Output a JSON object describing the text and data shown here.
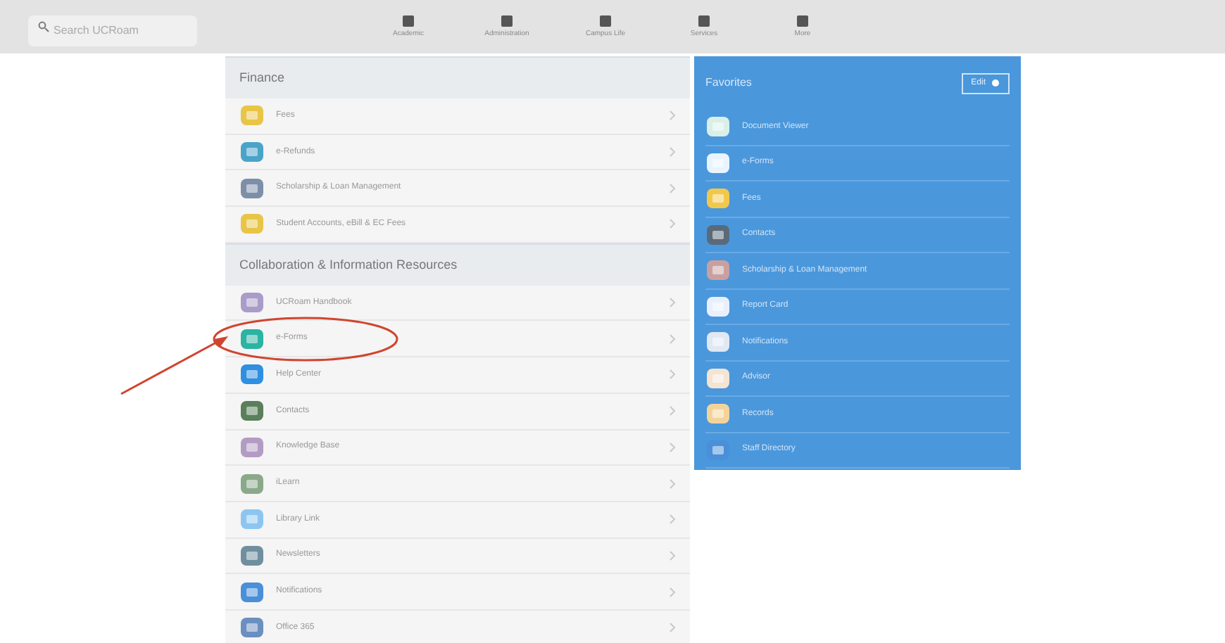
{
  "search": {
    "placeholder": "Search UCRoam"
  },
  "toolbar": [
    {
      "label": "Academic"
    },
    {
      "label": "Administration"
    },
    {
      "label": "Campus Life"
    },
    {
      "label": "Services"
    },
    {
      "label": "More"
    }
  ],
  "sections": [
    {
      "title": "Finance",
      "items": [
        {
          "label": "Fees"
        },
        {
          "label": "e-Refunds"
        },
        {
          "label": "Scholarship & Loan Management"
        },
        {
          "label": "Student Accounts, eBill & EC Fees"
        }
      ]
    },
    {
      "title": "Collaboration & Information Resources",
      "items": [
        {
          "label": "UCRoam Handbook"
        },
        {
          "label": "e-Forms"
        },
        {
          "label": "Help Center"
        },
        {
          "label": "Contacts"
        },
        {
          "label": "Knowledge Base"
        },
        {
          "label": "iLearn"
        },
        {
          "label": "Library Link"
        },
        {
          "label": "Newsletters"
        },
        {
          "label": "Notifications"
        },
        {
          "label": "Office 365"
        }
      ]
    }
  ],
  "favorites": {
    "title": "Favorites",
    "edit": "Edit",
    "items": [
      {
        "label": "Document Viewer"
      },
      {
        "label": "e-Forms"
      },
      {
        "label": "Fees"
      },
      {
        "label": "Contacts"
      },
      {
        "label": "Scholarship & Loan Management"
      },
      {
        "label": "Report Card"
      },
      {
        "label": "Notifications"
      },
      {
        "label": "Advisor"
      },
      {
        "label": "Records"
      },
      {
        "label": "Staff Directory"
      }
    ]
  }
}
